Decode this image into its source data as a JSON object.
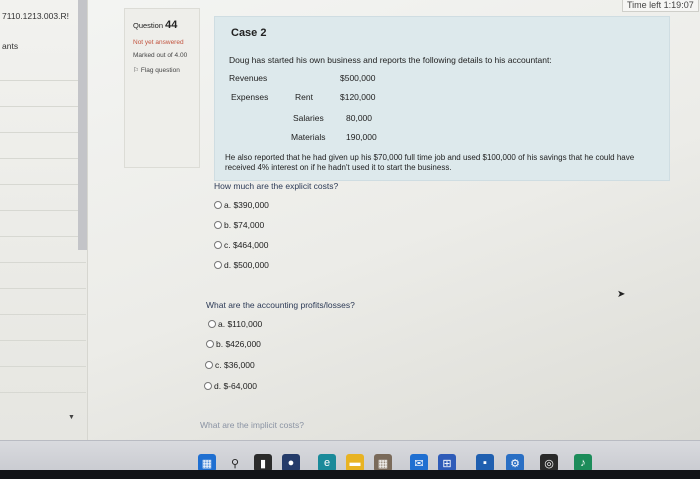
{
  "browser": {
    "url_fragment": "7110.1213.003.R!"
  },
  "left_nav": {
    "label": "ants"
  },
  "timer": {
    "text": "Time left 1:19:07"
  },
  "question_info": {
    "prefix": "Question",
    "number": "44",
    "status": "Not yet answered",
    "marked": "Marked out of 4.00",
    "flag": "Flag question"
  },
  "case": {
    "title": "Case 2",
    "intro": "Doug has started his own business and reports the following details to his accountant:",
    "revenues_label": "Revenues",
    "revenues_value": "$500,000",
    "expenses_label": "Expenses",
    "rent_label": "Rent",
    "rent_value": "$120,000",
    "salaries_label": "Salaries",
    "salaries_value": "80,000",
    "materials_label": "Materials",
    "materials_value": "190,000",
    "extra": "He also reported that he had given up his $70,000 full time job and used $100,000 of his savings that he could have received 4% interest on if he hadn't used it to start the business."
  },
  "questions": [
    {
      "text": "How much are the explicit costs?",
      "options": [
        "a. $390,000",
        "b. $74,000",
        "c. $464,000",
        "d. $500,000"
      ]
    },
    {
      "text": "What are the accounting profits/losses?",
      "options": [
        "a. $110,000",
        "b. $426,000",
        "c. $36,000",
        "d. $-64,000"
      ]
    },
    {
      "text": "What are the implicit costs?",
      "options": []
    }
  ],
  "taskbar": {
    "icons": [
      "windows-icon",
      "search-icon",
      "task-view-icon",
      "camera-icon",
      "edge-icon",
      "file-explorer-icon",
      "calendar-icon",
      "mail-icon",
      "store-icon",
      "chat-icon",
      "settings-icon",
      "chrome-icon",
      "music-icon"
    ]
  },
  "colors": {
    "case_box": "#dde9ec",
    "status_text": "#c2543f",
    "question_text": "#2c3a56",
    "taskbar": "#c6c8ce"
  }
}
